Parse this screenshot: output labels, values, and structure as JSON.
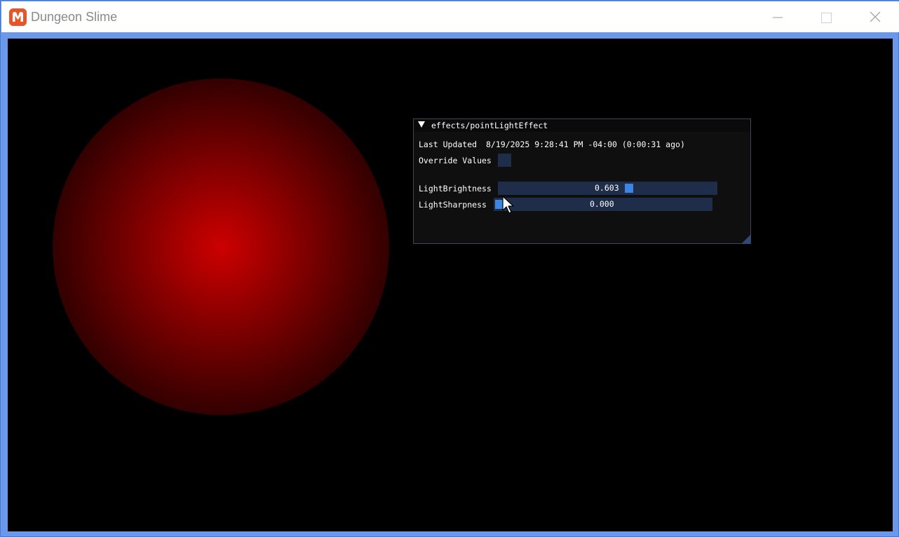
{
  "window": {
    "title": "Dungeon Slime",
    "accent_color": "#6b98ea"
  },
  "icons": {
    "app": "monogame-logo-icon",
    "minimize": "minimize-icon",
    "maximize": "maximize-icon",
    "close": "close-icon",
    "collapse": "triangle-down-icon",
    "cursor": "mouse-pointer-icon"
  },
  "scene": {
    "light_color": "#cc0000",
    "background": "#000000"
  },
  "effect_panel": {
    "title": "effects/pointLightEffect",
    "last_updated_label": "Last Updated",
    "last_updated_value": "8/19/2025 9:28:41 PM -04:00 (0:00:31 ago)",
    "override_label": "Override Values",
    "override_checked": false,
    "params": [
      {
        "label": "LightBrightness",
        "value": "0.603",
        "fraction": 0.603
      },
      {
        "label": "LightSharpness",
        "value": "0.000",
        "fraction": 0.0
      }
    ]
  }
}
